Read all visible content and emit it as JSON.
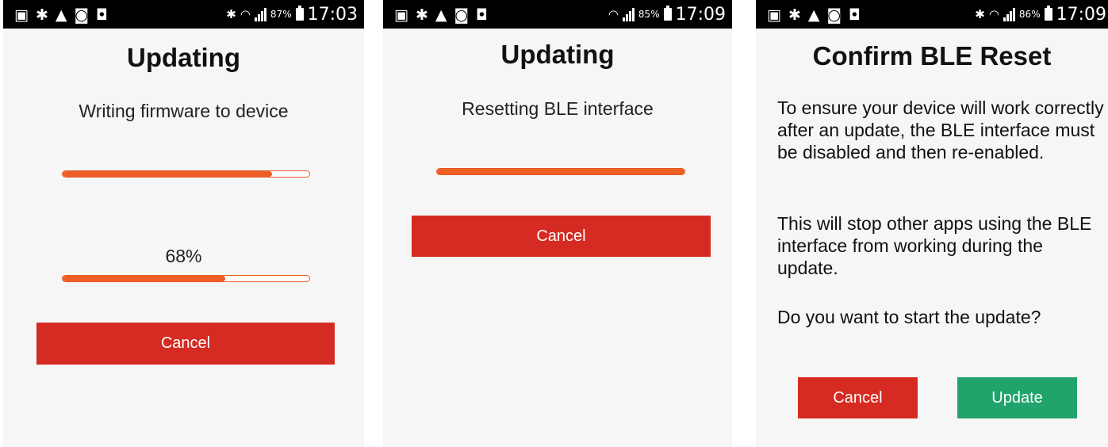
{
  "screens": [
    {
      "status": {
        "battery": "87%",
        "time": "17:03",
        "bluetooth": true
      },
      "title": "Updating",
      "subtitle": "Writing firmware to device",
      "overall_progress": 0.85,
      "percent_label": "68%",
      "file_progress": 0.66,
      "cancel_label": "Cancel"
    },
    {
      "status": {
        "battery": "85%",
        "time": "17:09",
        "bluetooth": false
      },
      "title": "Updating",
      "subtitle": "Resetting BLE interface",
      "progress": 1.0,
      "cancel_label": "Cancel"
    },
    {
      "status": {
        "battery": "86%",
        "time": "17:09",
        "bluetooth": true
      },
      "title": "Confirm BLE Reset",
      "paragraph1": "To ensure your device will work correctly after an update, the BLE interface must be disabled and then re-enabled.",
      "paragraph2": "This will stop other apps using the BLE interface from working during the update.",
      "paragraph3": "Do you want to start the update?",
      "cancel_label": "Cancel",
      "update_label": "Update"
    }
  ],
  "colors": {
    "accent_orange": "#ee5f26",
    "cancel_red": "#d62b22",
    "update_green": "#21a36c",
    "background": "#f6f6f6"
  },
  "icons": {
    "notifications": [
      "image-icon",
      "bluetooth-icon",
      "warning-icon",
      "sync-icon",
      "camera-icon"
    ],
    "status": [
      "bluetooth-icon",
      "wifi-icon",
      "signal-icon",
      "battery-icon"
    ]
  }
}
